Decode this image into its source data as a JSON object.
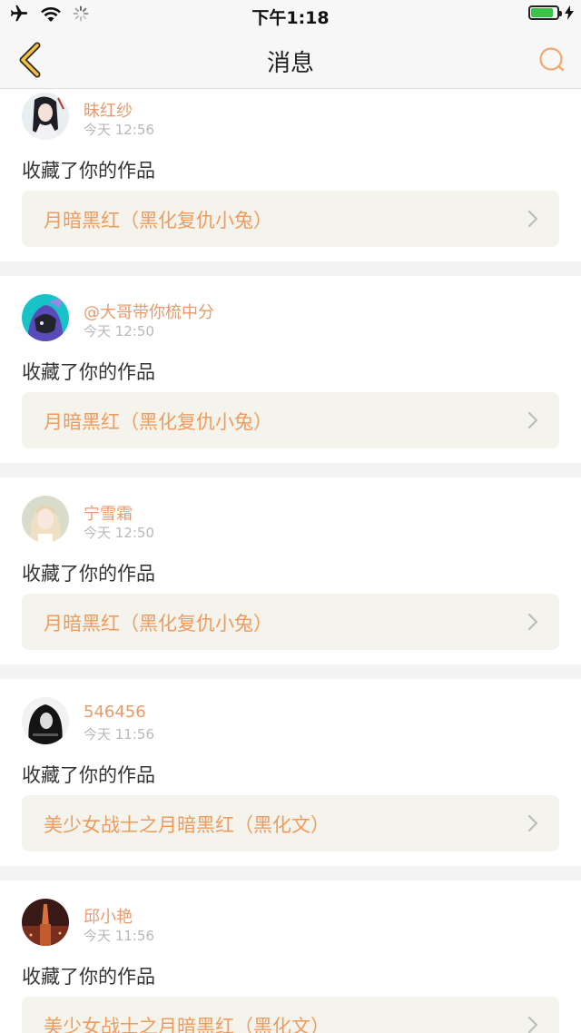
{
  "status_bar": {
    "time": "下午1:18",
    "icons": [
      "airplane-icon",
      "wifi-icon",
      "loading-spinner-icon",
      "battery-icon",
      "charging-bolt-icon"
    ],
    "battery_level": 0.85,
    "battery_color": "#3ac34a"
  },
  "nav": {
    "title": "消息",
    "back_icon": "chevron-left-icon",
    "search_icon": "search-icon",
    "accent_back": "#f2c343",
    "accent_search": "#f4a86f"
  },
  "messages": [
    {
      "username": "昧红纱",
      "time": "今天 12:56",
      "action": "收藏了你的作品",
      "work": "月暗黑红（黑化复仇小兔）"
    },
    {
      "username": "@大哥带你梳中分",
      "time": "今天 12:50",
      "action": "收藏了你的作品",
      "work": "月暗黑红（黑化复仇小兔）"
    },
    {
      "username": "宁雪霜",
      "time": "今天 12:50",
      "action": "收藏了你的作品",
      "work": "月暗黑红（黑化复仇小兔）"
    },
    {
      "username": "546456",
      "time": "今天 11:56",
      "action": "收藏了你的作品",
      "work": "美少女战士之月暗黑红（黑化文）"
    },
    {
      "username": "邱小艳",
      "time": "今天 11:56",
      "action": "收藏了你的作品",
      "work": "美少女战士之月暗黑红（黑化文）"
    }
  ],
  "colors": {
    "username": "#e89a6b",
    "work_title": "#ef9b5d",
    "work_bg": "#f4f3ec"
  }
}
